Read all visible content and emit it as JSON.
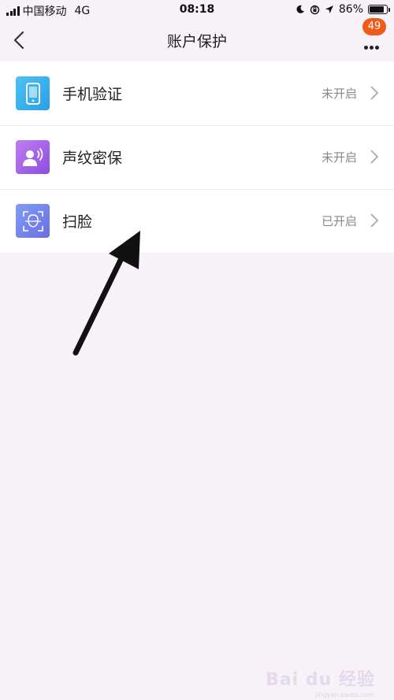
{
  "status_bar": {
    "carrier": "中国移动",
    "network": "4G",
    "time": "08:18",
    "battery": "86%",
    "battery_level": 0.86
  },
  "nav": {
    "title": "账户保护",
    "badge_count": "49"
  },
  "items": [
    {
      "label": "手机验证",
      "status": "未开启",
      "icon": "phone-icon",
      "color_start": "#4cc3f2",
      "color_end": "#2a9fe8"
    },
    {
      "label": "声纹密保",
      "status": "未开启",
      "icon": "voiceprint-icon",
      "color_start": "#c07ef0",
      "color_end": "#8a4de0"
    },
    {
      "label": "扫脸",
      "status": "已开启",
      "icon": "face-scan-icon",
      "color_start": "#7f9cf5",
      "color_end": "#6b6fe0"
    }
  ],
  "watermark": {
    "text": "Bai du 经验",
    "sub": "jingyan.baidu.com"
  }
}
